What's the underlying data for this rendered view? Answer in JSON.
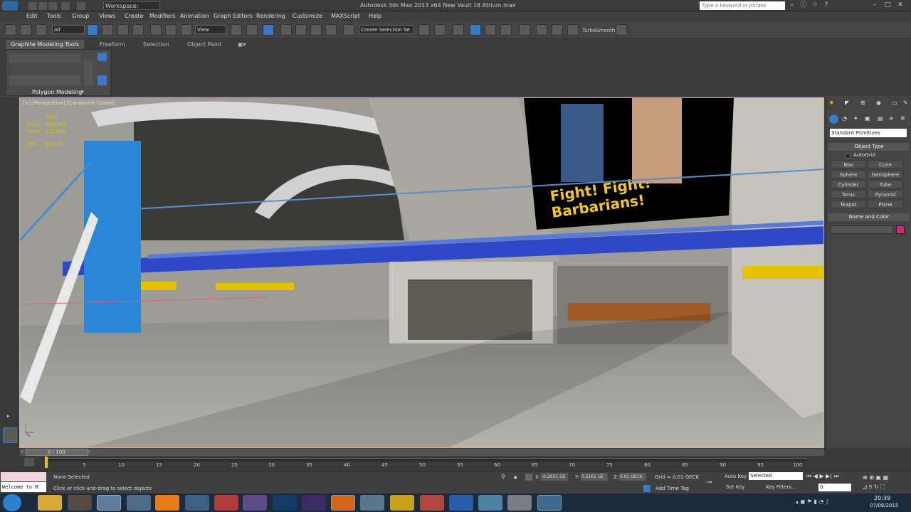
{
  "titlebar": {
    "workspace": "Workspace: Default",
    "app_title": "Autodesk 3ds Max  2013 x64      New Vault 18 Atrium.max",
    "search_placeholder": "Type a keyword or phrase"
  },
  "menu": [
    "Edit",
    "Tools",
    "Group",
    "Views",
    "Create",
    "Modifiers",
    "Animation",
    "Graph Editors",
    "Rendering",
    "Customize",
    "MAXScript",
    "Help"
  ],
  "toolbar": {
    "selection_filter": "All",
    "reference_coord": "View",
    "named_selection": "Create Selection Se",
    "turbosmooth": "TurboSmooth"
  },
  "ribbon": {
    "tabs": [
      "Graphite Modeling Tools",
      "Freeform",
      "Selection",
      "Object Paint"
    ],
    "panel_label": "Polygon Modeling"
  },
  "viewport": {
    "label": "[+] [Perspective] [Consistent Colors]",
    "stats_total": "Total",
    "polys_label": "Polys:",
    "polys_value": "100,652",
    "verts_label": "Verts:",
    "verts_value": "102,801",
    "fps_label": "FPS:",
    "fps_value": "60.597",
    "poster_text_1": "Fight! Fight!",
    "poster_text_2": "Barbarians!"
  },
  "command_panel": {
    "dropdown": "Standard Primitives",
    "object_type_header": "Object Type",
    "autogrid": "AutoGrid",
    "buttons": [
      "Box",
      "Cone",
      "Sphere",
      "GeoSphere",
      "Cylinder",
      "Tube",
      "Torus",
      "Pyramid",
      "Teapot",
      "Plane"
    ],
    "name_color_header": "Name and Color",
    "swatch_color": "#d6257a"
  },
  "timeline": {
    "frame_counter": "0 / 100",
    "ticks": [
      "0",
      "5",
      "10",
      "15",
      "20",
      "25",
      "30",
      "35",
      "40",
      "45",
      "50",
      "55",
      "60",
      "65",
      "70",
      "75",
      "80",
      "85",
      "90",
      "95",
      "100"
    ]
  },
  "status": {
    "welcome": "Welcome to M",
    "none_selected": "None Selected",
    "prompt": "Click or click-and-drag to select objects",
    "x_label": "X:",
    "x_value": "-0.2631 GE",
    "y_label": "Y:",
    "y_value": "0.5161 GE",
    "z_label": "Z:",
    "z_value": "0.01 GECK",
    "grid": "Grid = 0.01 GECK",
    "auto_key": "Auto Key",
    "selected": "Selected",
    "set_key": "Set Key",
    "key_filters": "Key Filters...",
    "add_time_tag": "Add Time Tag",
    "frame_value": "0"
  },
  "taskbar": {
    "time": "20:39",
    "date": "07/08/2015"
  }
}
